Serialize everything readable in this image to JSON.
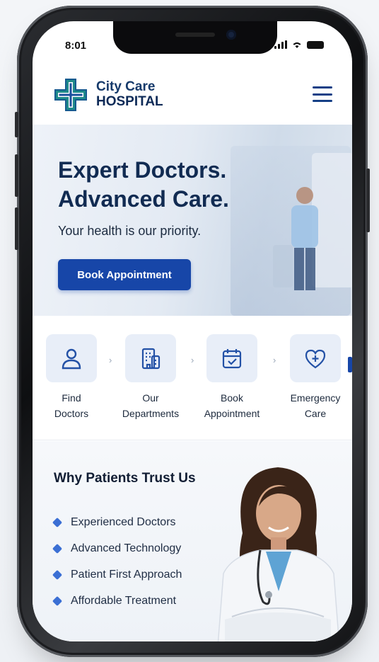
{
  "status_bar": {
    "time": "8:01"
  },
  "header": {
    "brand_line1": "City Care",
    "brand_line2": "HOSPITAL"
  },
  "hero": {
    "title_line1": "Expert Doctors.",
    "title_line2": "Advanced Care.",
    "subtitle": "Your health is our priority.",
    "cta_label": "Book Appointment"
  },
  "services": [
    {
      "line1": "Find",
      "line2": "Doctors",
      "icon": "user-icon"
    },
    {
      "line1": "Our",
      "line2": "Departments",
      "icon": "building-icon"
    },
    {
      "line1": "Book",
      "line2": "Appointment",
      "icon": "calendar-icon"
    },
    {
      "line1": "Emergency",
      "line2": "Care",
      "icon": "heart-icon"
    }
  ],
  "trust": {
    "title": "Why Patients Trust Us",
    "items": [
      "Experienced Doctors",
      "Advanced Technology",
      "Patient First Approach",
      "Affordable Treatment"
    ]
  },
  "colors": {
    "brand_blue": "#1746a8",
    "brand_teal": "#1f8a8a",
    "heading_navy": "#112b52"
  }
}
